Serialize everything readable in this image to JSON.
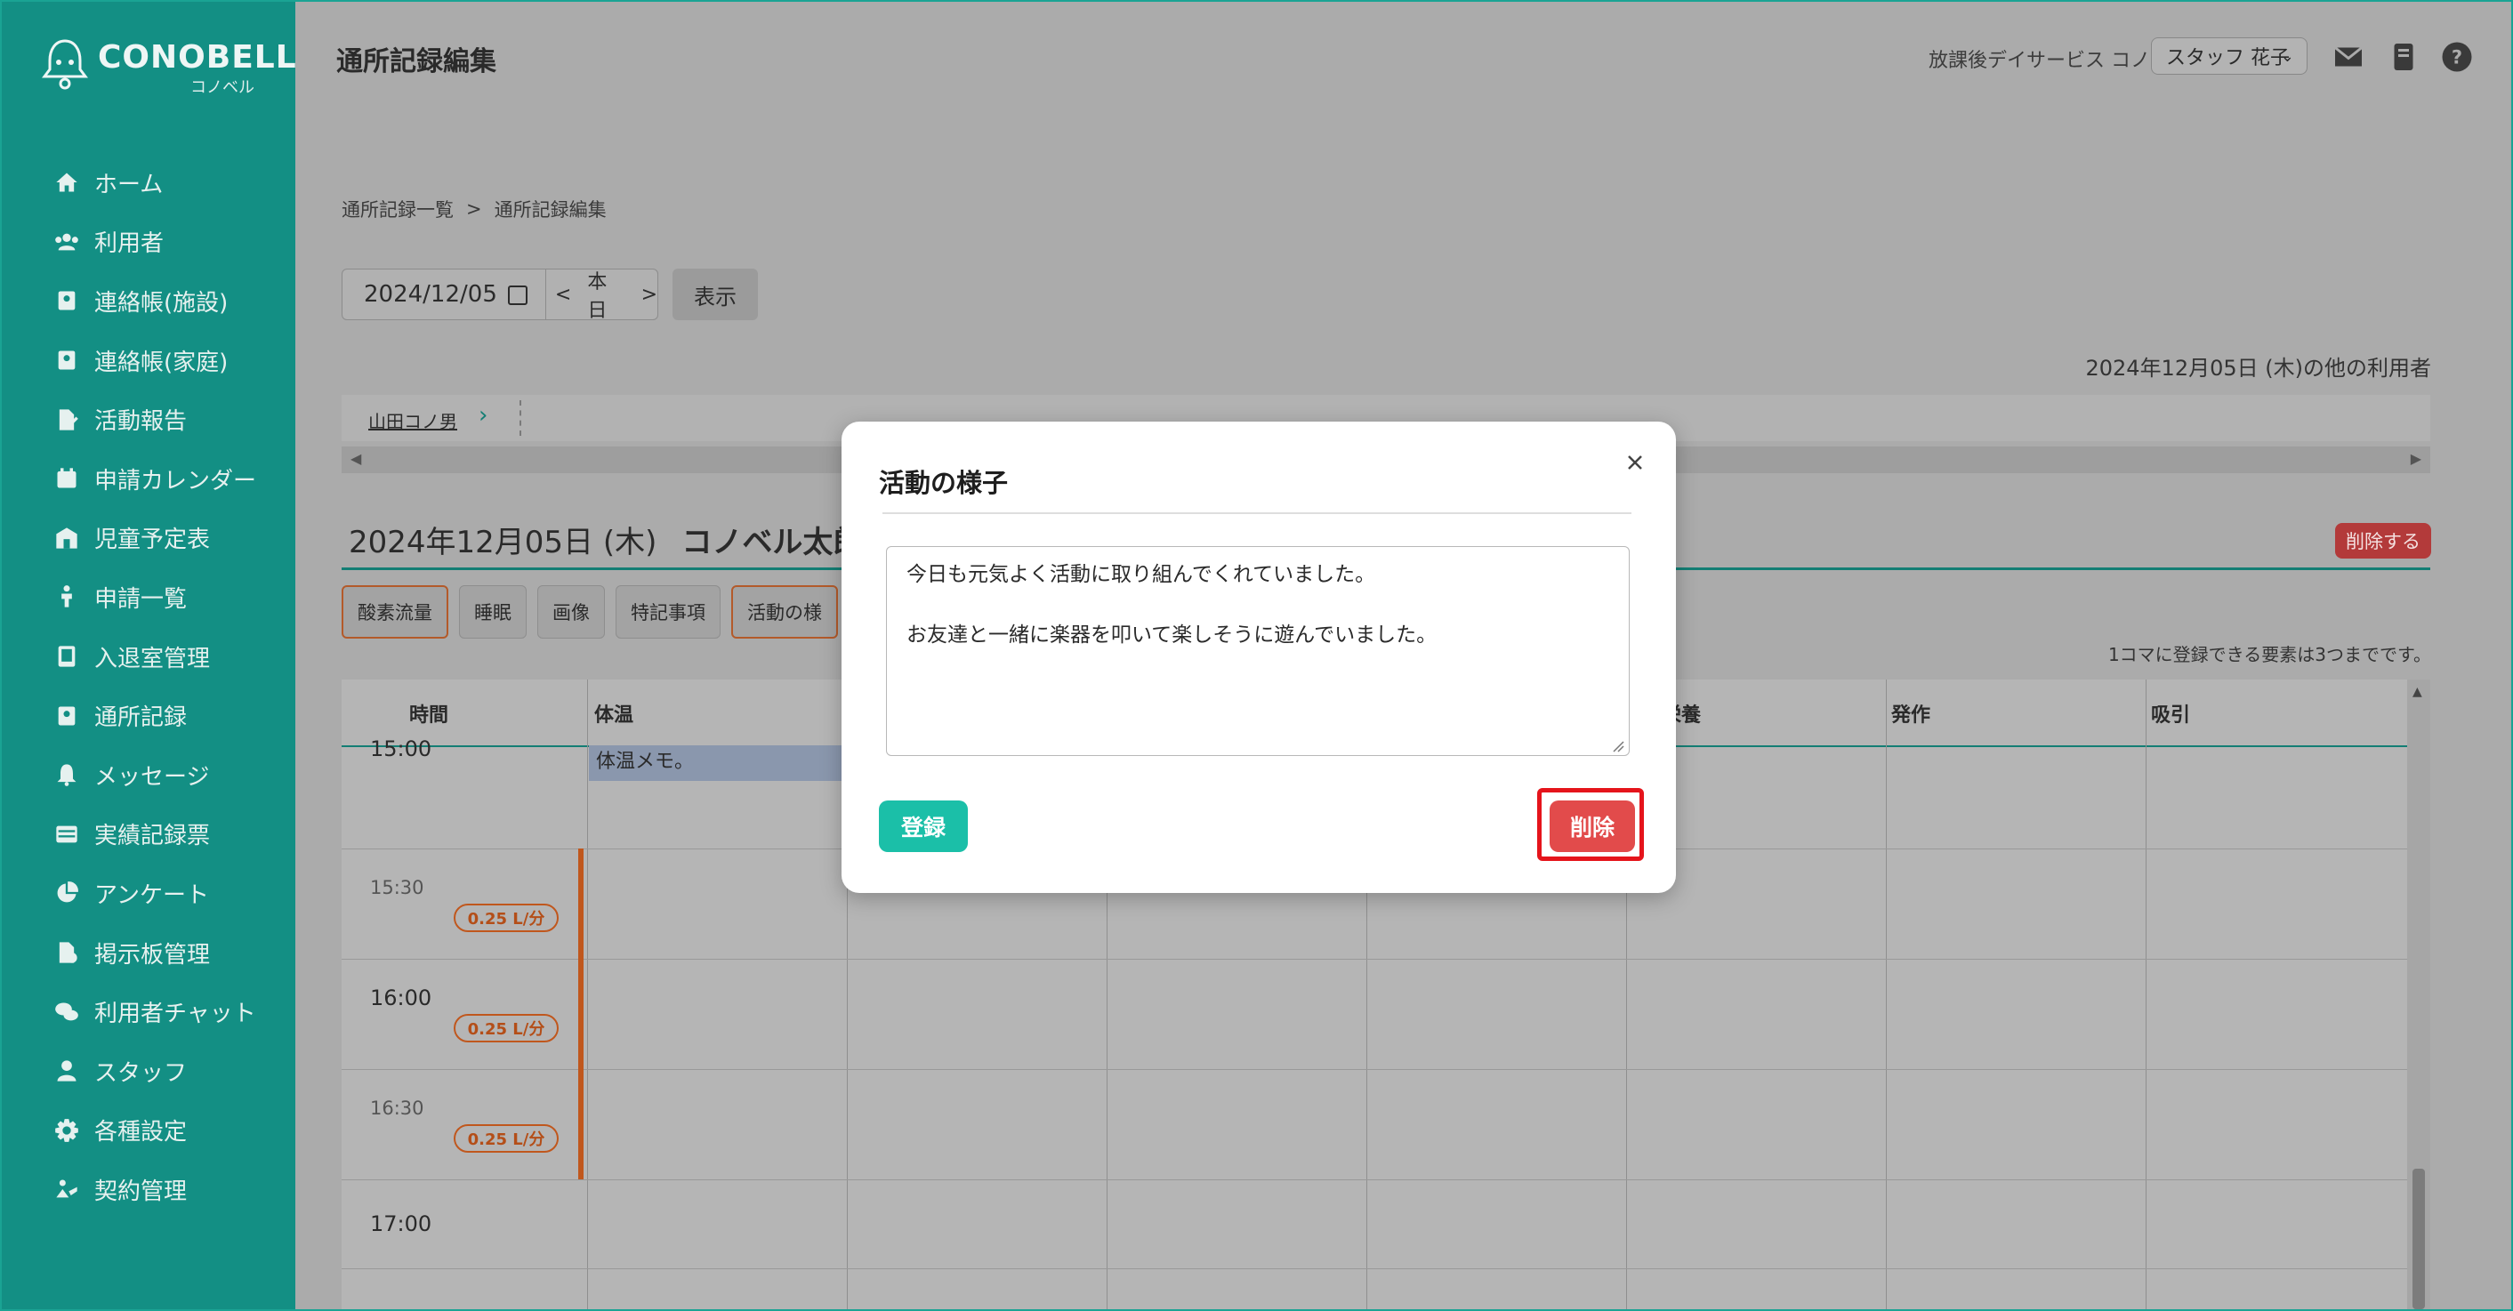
{
  "app": {
    "brand": "CONOBELL",
    "brand_sub": "コノベル",
    "page_title": "通所記録編集"
  },
  "header": {
    "facility": "放課後デイサービス コノベル",
    "staff": "スタッフ 花子"
  },
  "sidebar": {
    "items": [
      {
        "label": "ホーム",
        "icon": "home-icon"
      },
      {
        "label": "利用者",
        "icon": "users-icon"
      },
      {
        "label": "連絡帳(施設)",
        "icon": "contact-book-icon"
      },
      {
        "label": "連絡帳(家庭)",
        "icon": "contact-book-icon"
      },
      {
        "label": "活動報告",
        "icon": "report-edit-icon"
      },
      {
        "label": "申請カレンダー",
        "icon": "calendar-icon"
      },
      {
        "label": "児童予定表",
        "icon": "schedule-icon"
      },
      {
        "label": "申請一覧",
        "icon": "person-icon"
      },
      {
        "label": "入退室管理",
        "icon": "tablet-icon"
      },
      {
        "label": "通所記録",
        "icon": "record-icon"
      },
      {
        "label": "メッセージ",
        "icon": "bell-icon"
      },
      {
        "label": "実績記録票",
        "icon": "table-icon"
      },
      {
        "label": "アンケート",
        "icon": "pie-chart-icon"
      },
      {
        "label": "掲示板管理",
        "icon": "board-icon"
      },
      {
        "label": "利用者チャット",
        "icon": "chat-icon"
      },
      {
        "label": "スタッフ",
        "icon": "staff-icon"
      },
      {
        "label": "各種設定",
        "icon": "gear-icon"
      },
      {
        "label": "契約管理",
        "icon": "contract-icon"
      }
    ]
  },
  "breadcrumb": {
    "parent": "通所記録一覧",
    "sep": ">",
    "current": "通所記録編集"
  },
  "date_controls": {
    "date": "2024/12/05",
    "today": "本日",
    "show": "表示",
    "prev": "<",
    "next": ">"
  },
  "other_users": {
    "label": "2024年12月05日 (木)の他の利用者",
    "name": "山田コノ男"
  },
  "record": {
    "date": "2024年12月05日 (木)",
    "user": "コノベル太郎",
    "delete_label": "削除する"
  },
  "tabs": [
    "酸素流量",
    "睡眠",
    "画像",
    "特記事項",
    "活動の様"
  ],
  "limit_note": "1コマに登録できる要素は3つまでです。",
  "grid": {
    "headers": [
      {
        "label": "時間"
      },
      {
        "label": "体温"
      },
      {
        "label": "・栄養"
      },
      {
        "label": "発作"
      },
      {
        "label": "吸引"
      }
    ],
    "memo": "体温メモ。",
    "times": [
      "15:00",
      "15:30",
      "16:00",
      "16:30",
      "17:00"
    ],
    "oxygen": "0.25 L/分"
  },
  "modal": {
    "title": "活動の様子",
    "text": "今日も元気よく活動に取り組んでくれていました。\n\nお友達と一緒に楽器を叩いて楽しそうに遊んでいました。",
    "register": "登録",
    "delete": "削除"
  }
}
